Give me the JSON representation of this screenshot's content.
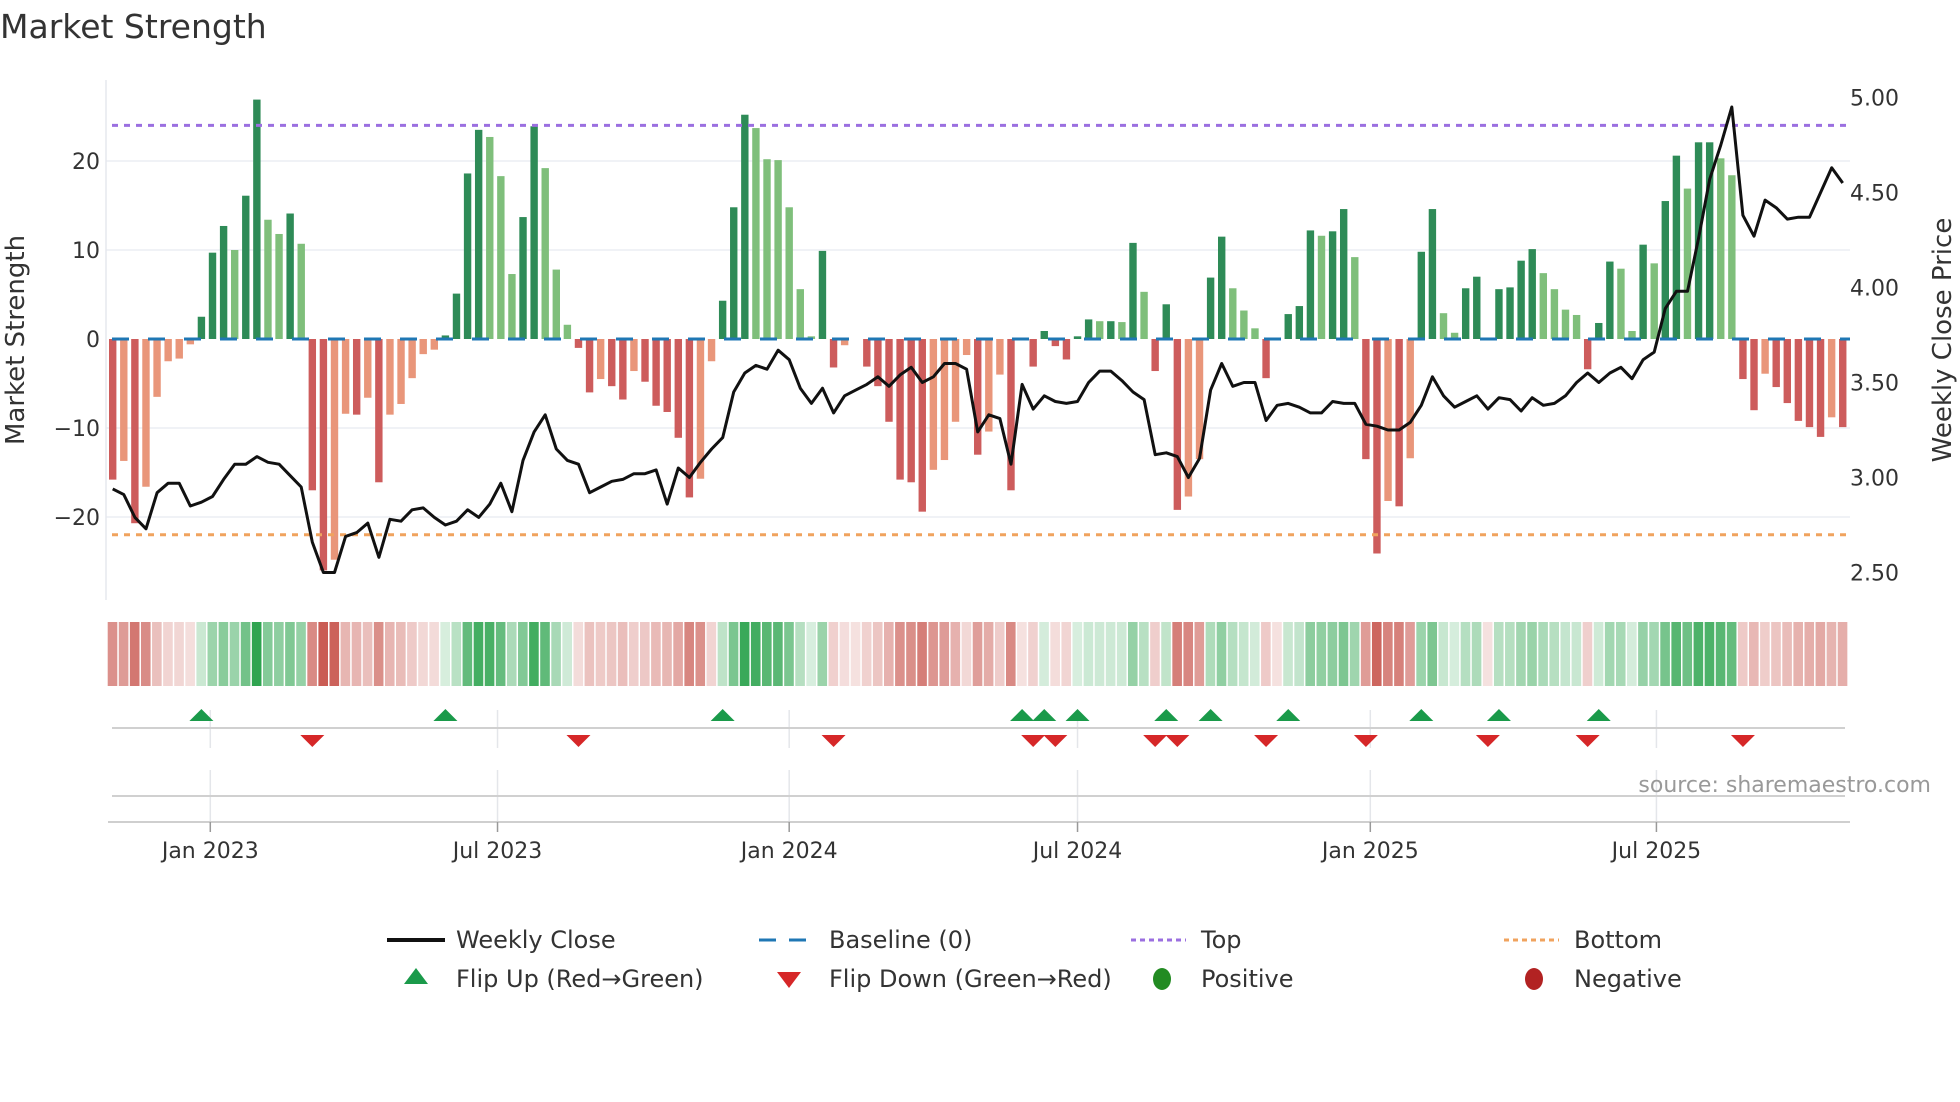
{
  "title": "Market Strength",
  "source": "source: sharemaestro.com",
  "colors": {
    "pos_dark": "#2e8b57",
    "pos_light": "#7fbf7b",
    "neg_dark": "#cd5c5c",
    "neg_light": "#e9967a",
    "baseline": "#1f77b4",
    "top": "#9b6fe0",
    "bottom": "#f0a35e",
    "close": "#111111",
    "flip_up": "#1a9a4a",
    "flip_down": "#d62728",
    "positive": "#228b22",
    "negative": "#b22222"
  },
  "legend": {
    "weekly_close": "Weekly Close",
    "baseline": "Baseline (0)",
    "top": "Top",
    "bottom": "Bottom",
    "flip_up": "Flip Up (Red→Green)",
    "flip_down": "Flip Down (Green→Red)",
    "positive": "Positive",
    "negative": "Negative"
  },
  "chart_data": {
    "type": "bar",
    "title": "Market Strength",
    "ylabel": "Market Strength",
    "y2label": "Weekly Close Price",
    "ylim": [
      -28,
      30
    ],
    "y2lim": [
      2.4,
      5.12
    ],
    "yticks": [
      {
        "v": 20,
        "label": "20"
      },
      {
        "v": 10,
        "label": "10"
      },
      {
        "v": 0,
        "label": "0"
      },
      {
        "v": -10,
        "label": "−10"
      },
      {
        "v": -20,
        "label": "−20"
      }
    ],
    "y2ticks": [
      {
        "v": 5.0,
        "label": "5.00"
      },
      {
        "v": 4.5,
        "label": "4.50"
      },
      {
        "v": 4.0,
        "label": "4.00"
      },
      {
        "v": 3.5,
        "label": "3.50"
      },
      {
        "v": 3.0,
        "label": "3.00"
      },
      {
        "v": 2.5,
        "label": "2.50"
      }
    ],
    "xticks": [
      {
        "week": 8.8,
        "label": "Jan 2023"
      },
      {
        "week": 34.7,
        "label": "Jul 2023"
      },
      {
        "week": 61.0,
        "label": "Jan 2024"
      },
      {
        "week": 87.0,
        "label": "Jul 2024"
      },
      {
        "week": 113.4,
        "label": "Jan 2025"
      },
      {
        "week": 139.2,
        "label": "Jul 2025"
      }
    ],
    "top_level": 24,
    "bottom_level": -22,
    "baseline": 0,
    "strength": [
      -15.8,
      -13.7,
      -20.7,
      -16.6,
      -6.5,
      -2.5,
      -2.2,
      -0.6,
      2.5,
      9.7,
      12.7,
      10.0,
      16.1,
      26.9,
      13.4,
      11.8,
      14.1,
      10.7,
      -17.0,
      -26.0,
      -24.8,
      -8.4,
      -8.5,
      -6.6,
      -16.1,
      -8.5,
      -7.3,
      -4.4,
      -1.7,
      -1.2,
      0.4,
      5.1,
      18.6,
      23.5,
      22.7,
      18.3,
      7.3,
      13.7,
      23.9,
      19.2,
      7.8,
      1.6,
      -1.0,
      -6.0,
      -4.5,
      -5.3,
      -6.8,
      -3.6,
      -4.8,
      -7.5,
      -8.2,
      -11.1,
      -17.8,
      -15.7,
      -2.5,
      4.3,
      14.8,
      25.2,
      23.7,
      20.2,
      20.1,
      14.8,
      5.6,
      0.3,
      9.9,
      -3.2,
      -0.7,
      0,
      -3.1,
      -5.3,
      -9.3,
      -15.8,
      -16.1,
      -19.4,
      -14.7,
      -13.6,
      -9.3,
      -1.8,
      -13.0,
      -10.4,
      -4.0,
      -17.0,
      0,
      -3.1,
      0.9,
      -0.8,
      -2.3,
      0.3,
      2.2,
      2.0,
      2.0,
      1.9,
      10.8,
      5.3,
      -3.6,
      3.9,
      -19.2,
      -17.7,
      -13.5,
      6.9,
      11.5,
      5.7,
      3.2,
      1.2,
      -4.4,
      0,
      2.8,
      3.7,
      12.2,
      11.6,
      12.1,
      14.6,
      9.2,
      -13.5,
      -24.1,
      -18.2,
      -18.8,
      -13.4,
      9.8,
      14.6,
      2.9,
      0.7,
      5.7,
      7.0,
      0,
      5.6,
      5.8,
      8.8,
      10.1,
      7.4,
      5.6,
      3.3,
      2.7,
      -3.4,
      1.8,
      8.7,
      7.9,
      0.9,
      10.6,
      8.5,
      15.5,
      20.6,
      16.9,
      22.1,
      22.1,
      20.3,
      18.4,
      -4.5,
      -8.0,
      -3.9,
      -5.4,
      -7.2,
      -9.2,
      -9.9,
      -11.0,
      -8.8,
      -9.9
    ],
    "weekly_close": [
      2.94,
      2.91,
      2.79,
      2.73,
      2.92,
      2.97,
      2.97,
      2.85,
      2.87,
      2.9,
      2.99,
      3.07,
      3.07,
      3.11,
      3.08,
      3.07,
      3.01,
      2.95,
      2.66,
      2.5,
      2.5,
      2.69,
      2.71,
      2.76,
      2.58,
      2.78,
      2.77,
      2.83,
      2.84,
      2.79,
      2.75,
      2.77,
      2.83,
      2.79,
      2.86,
      2.97,
      2.82,
      3.09,
      3.24,
      3.33,
      3.15,
      3.09,
      3.07,
      2.92,
      2.95,
      2.98,
      2.99,
      3.02,
      3.02,
      3.04,
      2.86,
      3.05,
      3.0,
      3.08,
      3.15,
      3.21,
      3.45,
      3.55,
      3.59,
      3.57,
      3.67,
      3.62,
      3.47,
      3.39,
      3.47,
      3.34,
      3.43,
      3.46,
      3.49,
      3.53,
      3.48,
      3.54,
      3.58,
      3.5,
      3.53,
      3.6,
      3.6,
      3.57,
      3.24,
      3.33,
      3.31,
      3.07,
      3.49,
      3.36,
      3.43,
      3.4,
      3.39,
      3.4,
      3.5,
      3.56,
      3.56,
      3.51,
      3.45,
      3.41,
      3.12,
      3.13,
      3.11,
      3.0,
      3.1,
      3.46,
      3.6,
      3.48,
      3.5,
      3.5,
      3.3,
      3.38,
      3.39,
      3.37,
      3.34,
      3.34,
      3.4,
      3.39,
      3.39,
      3.28,
      3.27,
      3.25,
      3.25,
      3.29,
      3.38,
      3.53,
      3.43,
      3.37,
      3.4,
      3.43,
      3.36,
      3.42,
      3.41,
      3.35,
      3.42,
      3.38,
      3.39,
      3.43,
      3.5,
      3.55,
      3.5,
      3.55,
      3.58,
      3.52,
      3.62,
      3.66,
      3.89,
      3.98,
      3.98,
      4.26,
      4.57,
      4.75,
      4.95,
      4.38,
      4.27,
      4.46,
      4.42,
      4.36,
      4.37,
      4.37,
      4.5,
      4.63,
      4.55
    ],
    "flip_up_weeks": [
      8,
      30,
      55,
      82,
      84,
      87,
      95,
      99,
      106,
      118,
      125,
      134
    ],
    "flip_down_weeks": [
      18,
      42,
      65,
      83,
      85,
      94,
      96,
      104,
      113,
      124,
      133,
      147
    ]
  }
}
